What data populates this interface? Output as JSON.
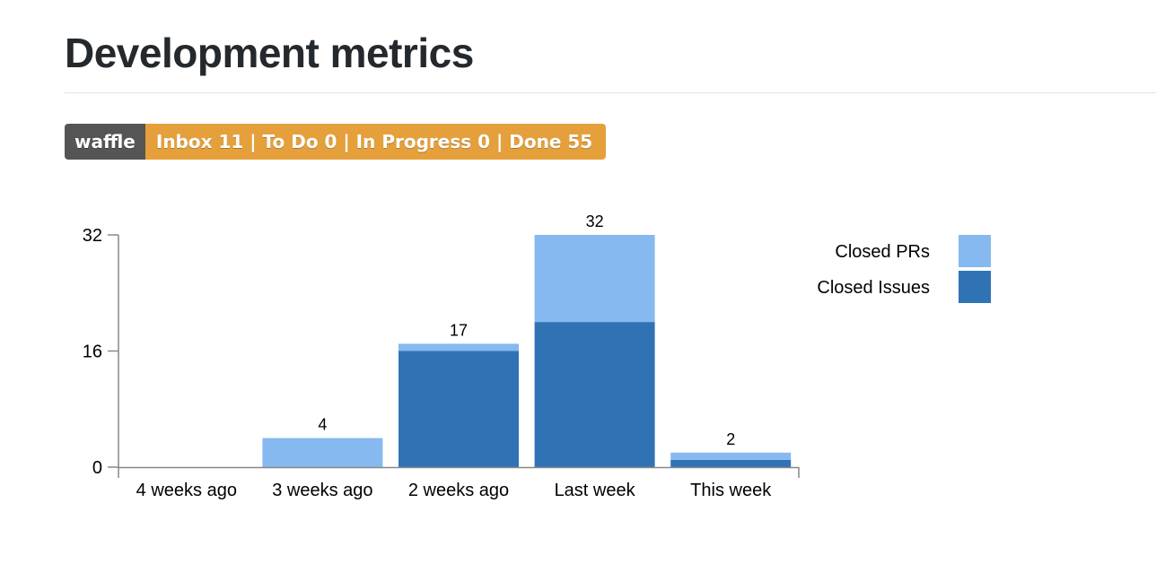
{
  "page": {
    "title": "Development metrics"
  },
  "badge": {
    "label": "waffle",
    "message": "Inbox 11 | To Do 0 | In Progress 0 | Done 55",
    "label_color": "#555555",
    "message_color": "#e5a03c"
  },
  "chart_data": {
    "type": "bar",
    "stacked": true,
    "categories": [
      "4 weeks ago",
      "3 weeks ago",
      "2 weeks ago",
      "Last week",
      "This week"
    ],
    "series": [
      {
        "name": "Closed Issues",
        "color": "#3073b5",
        "values": [
          0,
          0,
          16,
          20,
          1
        ]
      },
      {
        "name": "Closed PRs",
        "color": "#86b9f0",
        "values": [
          0,
          4,
          1,
          12,
          1
        ]
      }
    ],
    "totals": [
      null,
      4,
      17,
      32,
      2
    ],
    "yticks": [
      0,
      16,
      32
    ],
    "ylim": [
      0,
      32
    ],
    "legend_position": "right",
    "grid": false
  }
}
